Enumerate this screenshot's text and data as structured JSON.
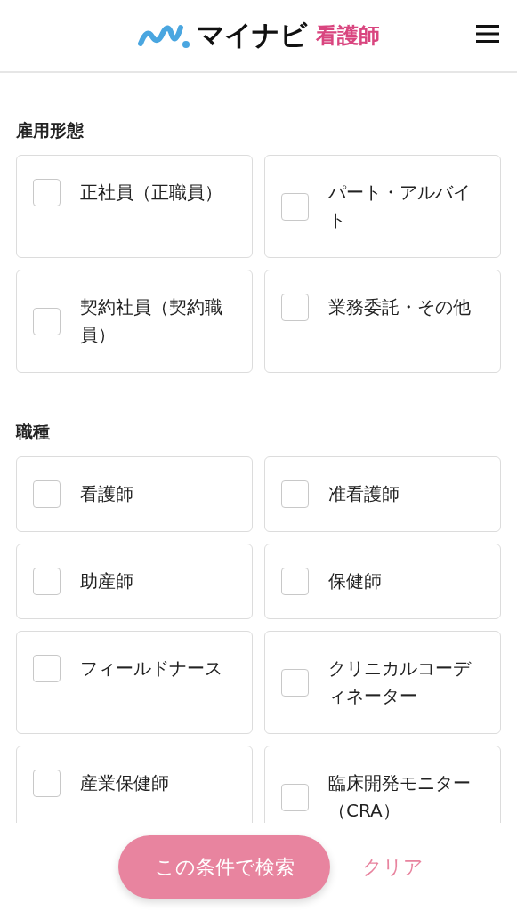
{
  "header": {
    "logo_main": "マイナビ",
    "logo_sub": "看護師"
  },
  "sections": [
    {
      "title": "雇用形態",
      "options": [
        {
          "label": "正社員（正職員）",
          "checked": false
        },
        {
          "label": "パート・アルバイト",
          "checked": false
        },
        {
          "label": "契約社員（契約職員）",
          "checked": false
        },
        {
          "label": "業務委託・その他",
          "checked": false
        }
      ]
    },
    {
      "title": "職種",
      "options": [
        {
          "label": "看護師",
          "checked": false
        },
        {
          "label": "准看護師",
          "checked": false
        },
        {
          "label": "助産師",
          "checked": false
        },
        {
          "label": "保健師",
          "checked": false
        },
        {
          "label": "フィールドナース",
          "checked": false
        },
        {
          "label": "クリニカルコーディネーター",
          "checked": false
        },
        {
          "label": "産業保健師",
          "checked": false
        },
        {
          "label": "臨床開発モニター（CRA）",
          "checked": false
        }
      ]
    }
  ],
  "footer": {
    "search_button": "この条件で検索",
    "clear_link": "クリア"
  }
}
